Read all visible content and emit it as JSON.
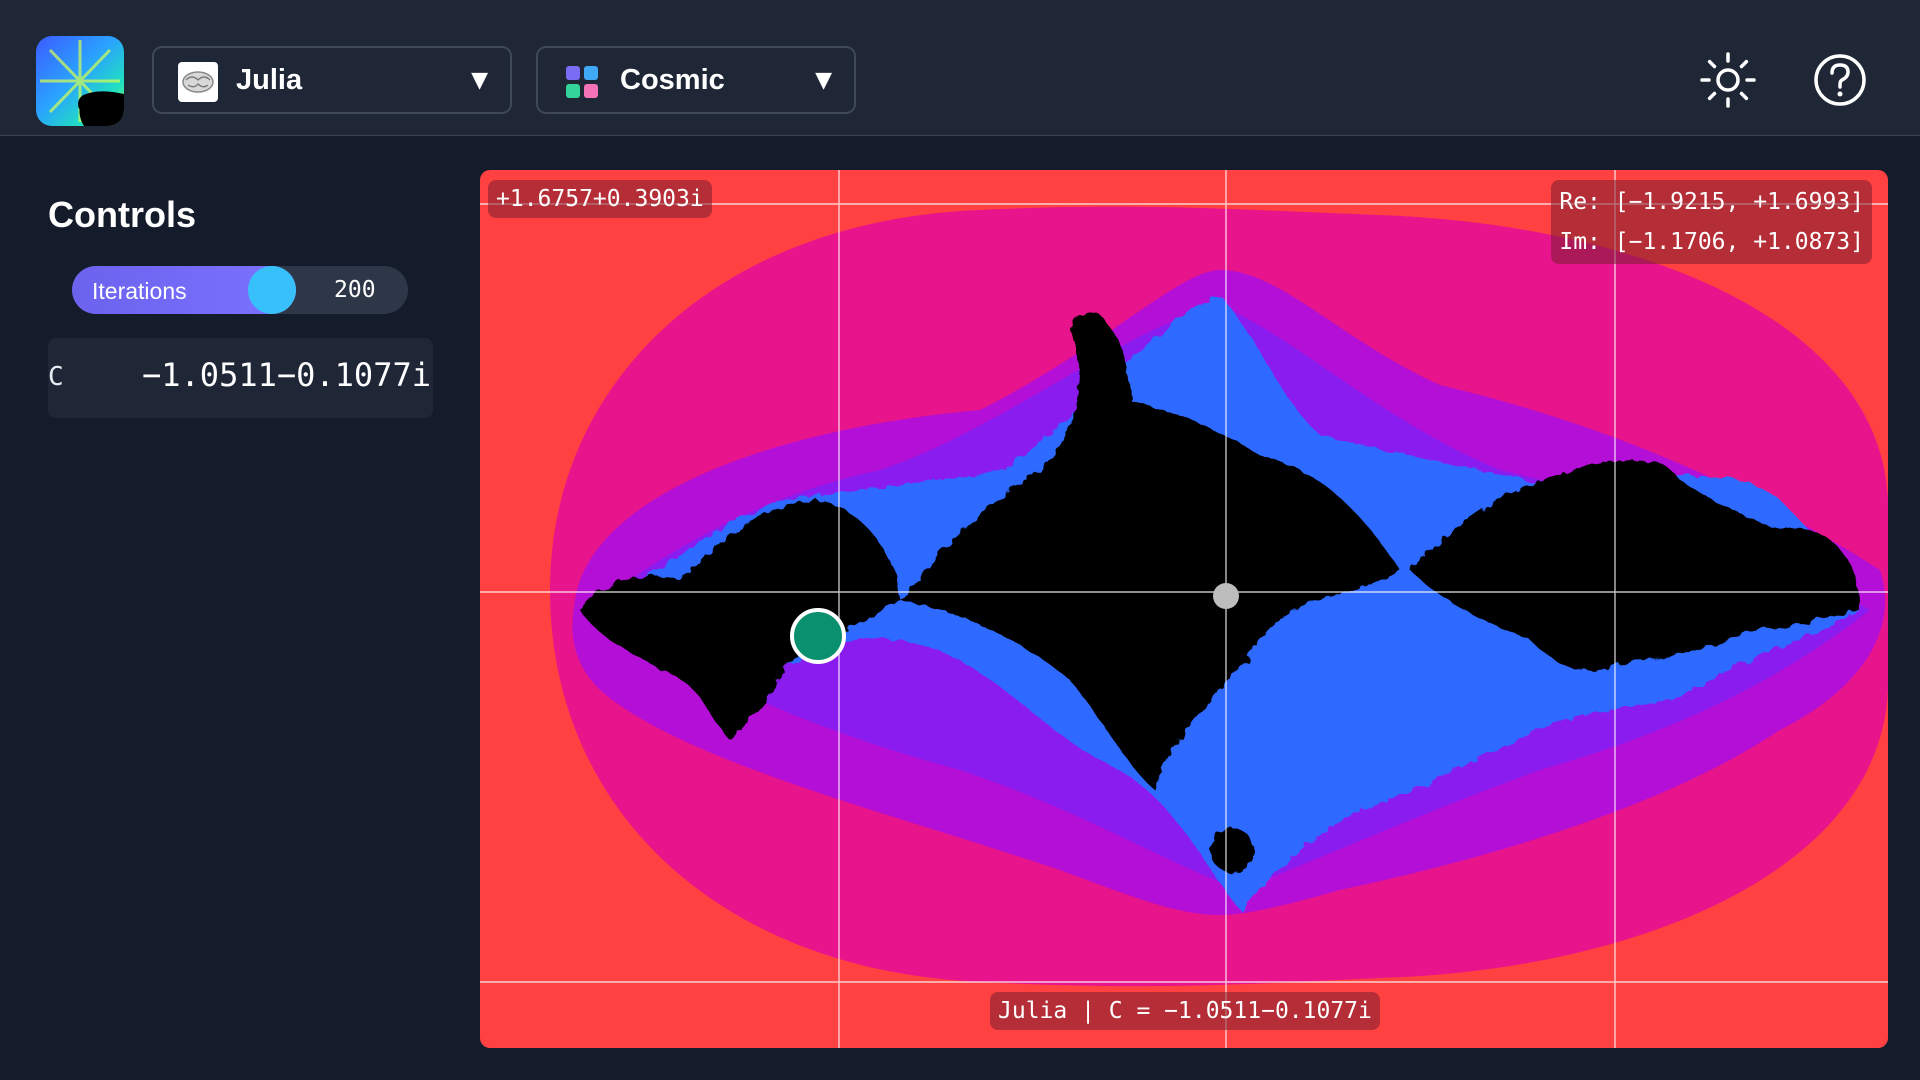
{
  "header": {
    "fractal_selector": {
      "label": "Julia",
      "icon": "brain-icon"
    },
    "palette_selector": {
      "label": "Cosmic",
      "icon": "palette-grid-icon"
    },
    "theme_button": {
      "icon": "sun-icon"
    },
    "help_button": {
      "icon": "question-circle-icon"
    }
  },
  "sidebar": {
    "title": "Controls",
    "iterations": {
      "label": "Iterations",
      "value": "200",
      "fraction": 0.61
    },
    "c_param": {
      "label": "C",
      "value": "−1.0511−0.1077i"
    }
  },
  "canvas": {
    "cursor_coord": "+1.6757+0.3903i",
    "range_re": "Re: [−1.9215, +1.6993]",
    "range_im": "Im: [−1.1706, +1.0873]",
    "caption": "Julia | C = −1.0511−0.1077i"
  },
  "colors": {
    "background": "#141b2b",
    "header": "#1f2737",
    "accent": "#6b62ee",
    "slider_thumb": "#38c0fb",
    "fractal_outer": "#ff4141",
    "fractal_band1": "#e8148c",
    "fractal_band2": "#b40fd6",
    "fractal_band3": "#8a1cf0",
    "fractal_edge": "#2d6bff",
    "fractal_inside": "#000000",
    "marker": "#0a8f6f"
  }
}
